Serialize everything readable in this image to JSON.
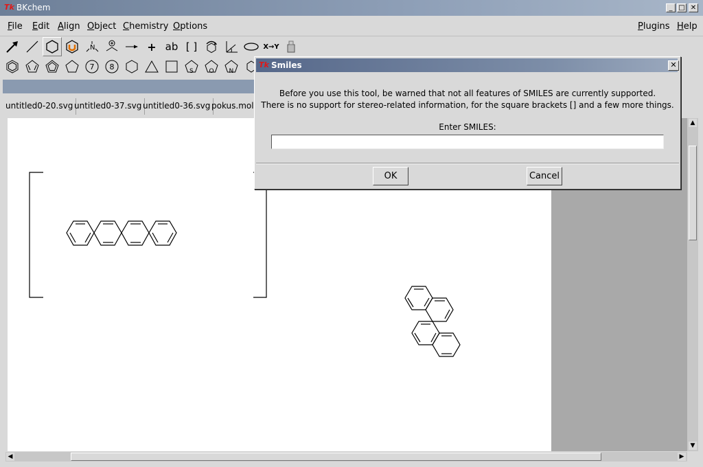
{
  "window": {
    "title": "BKchem",
    "logo": "Tk",
    "min": "_",
    "max": "□",
    "close": "✕"
  },
  "menu": {
    "left": [
      {
        "label": "File",
        "key": "F",
        "rest": "ile"
      },
      {
        "label": "Edit",
        "key": "E",
        "rest": "dit"
      },
      {
        "label": "Align",
        "key": "A",
        "rest": "lign"
      },
      {
        "label": "Object",
        "key": "O",
        "rest": "bject"
      },
      {
        "label": "Chemistry",
        "key": "C",
        "rest": "hemistry"
      },
      {
        "label": "Options",
        "key": "O",
        "rest": "ptions"
      }
    ],
    "right": [
      {
        "label": "Plugins",
        "key": "P",
        "rest": "lugins"
      },
      {
        "label": "Help",
        "key": "H",
        "rest": "elp"
      }
    ]
  },
  "toolbar": {
    "row1": [
      "edit-arrow",
      "draw-line",
      "template",
      "biotemplate",
      "user-template",
      "atom",
      "charge",
      "reaction-arrow",
      "plus",
      "text",
      "bracket",
      "rotate",
      "bond-align",
      "vector-ellipse",
      "mark",
      "misc"
    ],
    "row1_text": {
      "text": "ab",
      "bracket": "[ ]",
      "plus": "+",
      "mark": "X→Y"
    },
    "row2": [
      "benzene",
      "cyclopentadiene",
      "cp-ring",
      "pentagon",
      "ring-7",
      "ring-8",
      "hexagon",
      "triangle",
      "square",
      "thiophene",
      "furan",
      "pyrrole",
      "more"
    ],
    "row2_text": {
      "ring-7": "7",
      "ring-8": "8"
    }
  },
  "tabs": [
    "untitled0-20.svg",
    "untitled0-37.svg",
    "untitled0-36.svg",
    "pokus.mol"
  ],
  "dialog": {
    "title": "Smiles",
    "line1": "Before you use this tool, be warned that not all features of SMILES are currently supported.",
    "line2": "There is no support for stereo-related information, for the square brackets [] and a few more things.",
    "prompt": "Enter SMILES:",
    "input_value": "",
    "ok": "OK",
    "cancel": "Cancel",
    "close": "✕"
  },
  "scroll": {
    "left": "◀",
    "right": "▶",
    "up": "▲",
    "down": "▼"
  }
}
